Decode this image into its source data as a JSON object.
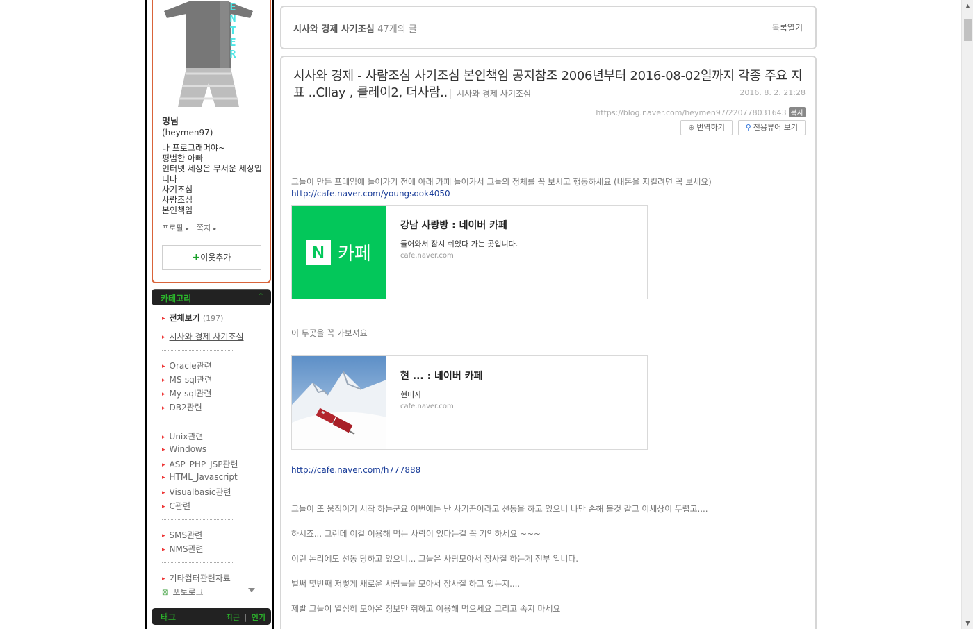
{
  "profile": {
    "nickname": "멍님",
    "user_id": "(heymen97)",
    "intro": "나 프로그래머야~\n평범한 아빠\n인터넷 세상은 무서운 세상입니다\n사기조심\n사람조심\n본인책임",
    "link_profile": "프로필",
    "link_message": "쪽지",
    "add_friend": "이웃추가",
    "shirt_text": "ENTER"
  },
  "category": {
    "header": "카테고리",
    "all_label": "전체보기",
    "all_count": "(197)",
    "items": [
      "시사와 경제 사기조심",
      "Oracle관련",
      "MS-sql관련",
      "My-sql관련",
      "DB2관련",
      "Unix관련",
      "Windows",
      "ASP_PHP_JSP관련",
      "HTML_Javascript",
      "Visualbasic관련",
      "C관련",
      "SMS관련",
      "NMS관련",
      "기타컴터관련자료",
      "포토로그"
    ]
  },
  "tags": {
    "header": "태그",
    "recent": "최근",
    "sep": "|",
    "popular": "인기"
  },
  "listbar": {
    "category": "시사와 경제 사기조심",
    "count": "47개의 글",
    "open": "목록열기"
  },
  "post": {
    "title": "시사와 경제 - 사람조심 사기조심 본인책임 공지참조 2006년부터 2016-08-02일까지 각종 주요 지표 ..Cllay , 클레이2, 더사람..",
    "category": "시사와 경제 사기조심",
    "date": "2016. 8. 2. 21:28",
    "url": "https://blog.naver.com/heymen97/220778031643",
    "copy": "복사",
    "translate": "번역하기",
    "viewer": "전용뷰어 보기",
    "para1": "그들이 만든 프레임에 들어가기 전에 아래 카페 들어가서 그들의 정체를 꼭 보시고 행동하세요 (내돈을 지킬려면 꼭 보세요)",
    "link1": "http://cafe.naver.com/youngsook4050",
    "card1": {
      "title": "강남 사랑방 : 네이버 카페",
      "desc": "들어와서 잠시 쉬었다 가는 곳입니다.",
      "domain": "cafe.naver.com",
      "logo_n": "N",
      "logo_text": "카페"
    },
    "para2": "이 두곳을 꼭 가보셔요",
    "card2": {
      "title": "현 ... : 네이버 카페",
      "desc": "현미자",
      "domain": "cafe.naver.com"
    },
    "link2": "http://cafe.naver.com/h777888",
    "para3": "그들이 또 움직이기 시작 하는군요 이번에는 난 사기꾼이라고 선동을 하고 있으니 나만 손해 볼것 같고 이세상이 두렵고....",
    "para4": "하시죠... 그런데 이걸 이용해 먹는 사람이 있다는걸 꼭 기억하세요 ~~~",
    "para5": "이런 논리에도 선동 당하고 있으니... 그들은 사람모아서 장사질 하는게 전부 입니다.",
    "para6": "벌써 몇번째 저렇게 새로운 사람들을 모아서 장사질 하고 있는지....",
    "para7": "제발 그들이 열심히 모아온 정보만 취하고 이용해 먹으세요 그리고 속지 마세요"
  },
  "colors": {
    "accent_green": "#2bb32b",
    "profile_border": "#d9643a",
    "naver_green": "#03c75a",
    "link_blue": "#1a3d99"
  }
}
